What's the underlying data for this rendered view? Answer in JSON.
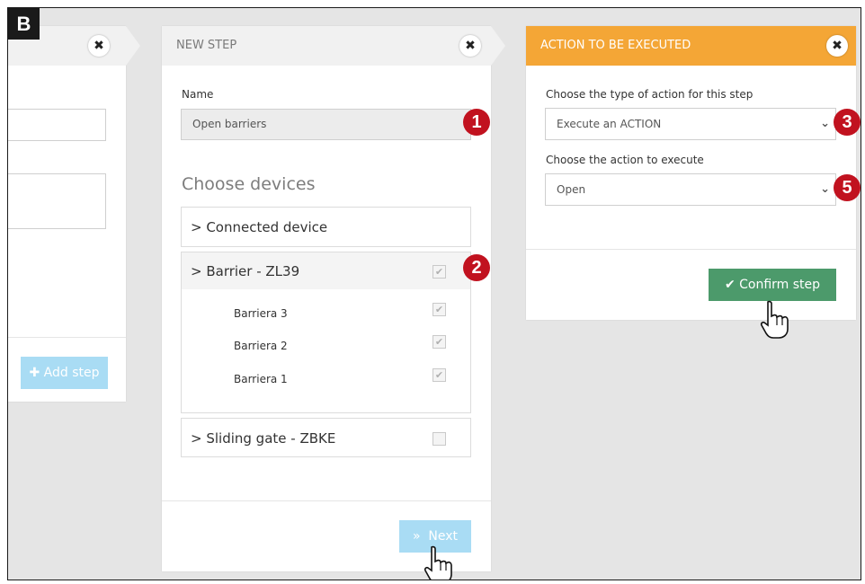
{
  "corner_label": "B",
  "panel_left": {
    "close_icon": "✖",
    "add_step_button": "Add step"
  },
  "panel_middle": {
    "title": "NEW STEP",
    "close_icon": "✖",
    "name_label": "Name",
    "name_value": "Open barriers",
    "choose_devices_heading": "Choose devices",
    "devices": {
      "connected": "> Connected device",
      "barrier": "> Barrier - ZL39",
      "barriera3": "Barriera 3",
      "barriera2": "Barriera 2",
      "barriera1": "Barriera 1",
      "sliding_gate": "> Sliding gate - ZBKE"
    },
    "checked": {
      "barrier": true,
      "barriera3": true,
      "barriera2": true,
      "barriera1": true,
      "sliding_gate": false
    },
    "next_button": "Next",
    "next_icon": "»"
  },
  "panel_right": {
    "title": "ACTION TO BE EXECUTED",
    "close_icon": "✖",
    "type_label": "Choose the type of action for this step",
    "type_value": "Execute an ACTION",
    "action_label": "Choose the action to execute",
    "action_value": "Open",
    "confirm_button": "Confirm step",
    "confirm_icon": "✔"
  },
  "badges": [
    "1",
    "2",
    "3",
    "5"
  ],
  "colors": {
    "accent_orange": "#f4a636",
    "badge_red": "#c1121f",
    "confirm_green": "#4c9a6b",
    "next_blue": "#a9dcf4"
  },
  "icons": {
    "close": "close-icon",
    "checkbox_check": "check-icon",
    "dropdown": "chevron-down-icon",
    "cursor": "hand-pointer-icon"
  }
}
